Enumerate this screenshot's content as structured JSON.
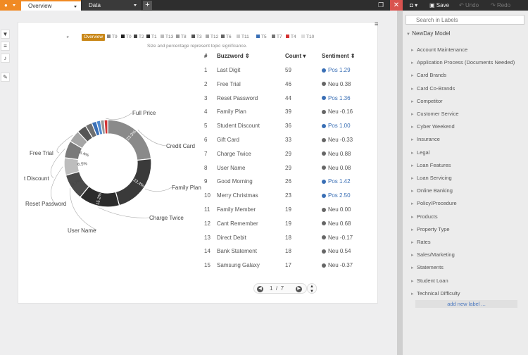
{
  "tabs": [
    {
      "label": "Overview"
    },
    {
      "label": "Data"
    }
  ],
  "toolbar": {
    "save": "Save",
    "undo": "Undo",
    "redo": "Redo"
  },
  "legend": [
    "Overview",
    "T9",
    "T0",
    "T2",
    "T1",
    "T13",
    "T8",
    "T3",
    "T12",
    "T6",
    "T11",
    "T5",
    "T7",
    "T4",
    "T10"
  ],
  "legend_colors": [
    "#c98717",
    "#888888",
    "#222222",
    "#444444",
    "#333333",
    "#bbbbbb",
    "#999999",
    "#555555",
    "#aaaaaa",
    "#666666",
    "#cccccc",
    "#3a6fb5",
    "#777777",
    "#d33333",
    "#dddddd"
  ],
  "subtitle": "Size and percentage represent topic significance.",
  "chart_data": {
    "type": "pie",
    "slices": [
      {
        "label": "Credit Card",
        "value": 23.3,
        "color": "#8a8a8a",
        "pct": "23.3%"
      },
      {
        "label": "Family Plan",
        "value": 22.4,
        "color": "#3a3a3a",
        "pct": "22.4%"
      },
      {
        "label": "Charge Twice",
        "value": 15.2,
        "color": "#2c2c2c",
        "pct": "15.2%"
      },
      {
        "label": "User Name",
        "value": 9.7,
        "color": "#4a4a4a",
        "pct": "9.7%"
      },
      {
        "label": "Reset Password",
        "value": 6.5,
        "color": "#bdbdbd",
        "pct": "6.5%"
      },
      {
        "label": "t Discount",
        "value": 6.4,
        "color": "#7a7a7a",
        "pct": "6.4%"
      },
      {
        "label": "Free Trial",
        "value": 4.5,
        "color": "#a5a5a5",
        "pct": ""
      },
      {
        "label": "",
        "value": 3.5,
        "color": "#555555",
        "pct": ""
      },
      {
        "label": "",
        "value": 2.5,
        "color": "#6f6f6f",
        "pct": ""
      },
      {
        "label": "",
        "value": 1.8,
        "color": "#3a6fb5",
        "pct": ""
      },
      {
        "label": "",
        "value": 1.5,
        "color": "#4f8ad0",
        "pct": ""
      },
      {
        "label": "",
        "value": 1.4,
        "color": "#999999",
        "pct": ""
      },
      {
        "label": "Full Price",
        "value": 1.3,
        "color": "#d33333",
        "pct": ""
      }
    ]
  },
  "table": {
    "headers": {
      "num": "#",
      "buzzword": "Buzzword",
      "count": "Count",
      "sentiment": "Sentiment"
    },
    "rows": [
      {
        "n": "1",
        "word": "Last Digit",
        "count": "59",
        "sent": "Pos 1.29",
        "pos": true
      },
      {
        "n": "2",
        "word": "Free Trial",
        "count": "46",
        "sent": "Neu 0.38",
        "pos": false
      },
      {
        "n": "3",
        "word": "Reset Password",
        "count": "44",
        "sent": "Pos 1.36",
        "pos": true
      },
      {
        "n": "4",
        "word": "Family Plan",
        "count": "39",
        "sent": "Neu -0.16",
        "pos": false
      },
      {
        "n": "5",
        "word": "Student Discount",
        "count": "36",
        "sent": "Pos 1.00",
        "pos": true
      },
      {
        "n": "6",
        "word": "Gift Card",
        "count": "33",
        "sent": "Neu -0.33",
        "pos": false
      },
      {
        "n": "7",
        "word": "Charge Twice",
        "count": "29",
        "sent": "Neu 0.88",
        "pos": false
      },
      {
        "n": "8",
        "word": "User Name",
        "count": "29",
        "sent": "Neu 0.08",
        "pos": false
      },
      {
        "n": "9",
        "word": "Good Morning",
        "count": "26",
        "sent": "Pos 1.42",
        "pos": true
      },
      {
        "n": "10",
        "word": "Merry Christmas",
        "count": "23",
        "sent": "Pos 2.50",
        "pos": true
      },
      {
        "n": "11",
        "word": "Family Member",
        "count": "19",
        "sent": "Neu 0.00",
        "pos": false
      },
      {
        "n": "12",
        "word": "Cant Remember",
        "count": "19",
        "sent": "Neu 0.68",
        "pos": false
      },
      {
        "n": "13",
        "word": "Direct Debit",
        "count": "18",
        "sent": "Neu -0.17",
        "pos": false
      },
      {
        "n": "14",
        "word": "Bank Statement",
        "count": "18",
        "sent": "Neu 0.54",
        "pos": false
      },
      {
        "n": "15",
        "word": "Samsung Galaxy",
        "count": "17",
        "sent": "Neu -0.37",
        "pos": false
      }
    ]
  },
  "pager": {
    "page": "1",
    "sep": "/",
    "total": "7"
  },
  "right": {
    "search_placeholder": "Search in Labels",
    "root": "NewDay Model",
    "items": [
      "Account Maintenance",
      "Application Process (Documents Needed)",
      "Card Brands",
      "Card Co-Brands",
      "Competitor",
      "Customer Service",
      "Cyber Weekend",
      "Insurance",
      "Legal",
      "Loan Features",
      "Loan Servicing",
      "Online Banking",
      "Policy/Procedure",
      "Products",
      "Property Type",
      "Rates",
      "Sales/Marketing",
      "Statements",
      "Student Loan",
      "Technical Difficulty"
    ],
    "add_label": "add new label ..."
  }
}
